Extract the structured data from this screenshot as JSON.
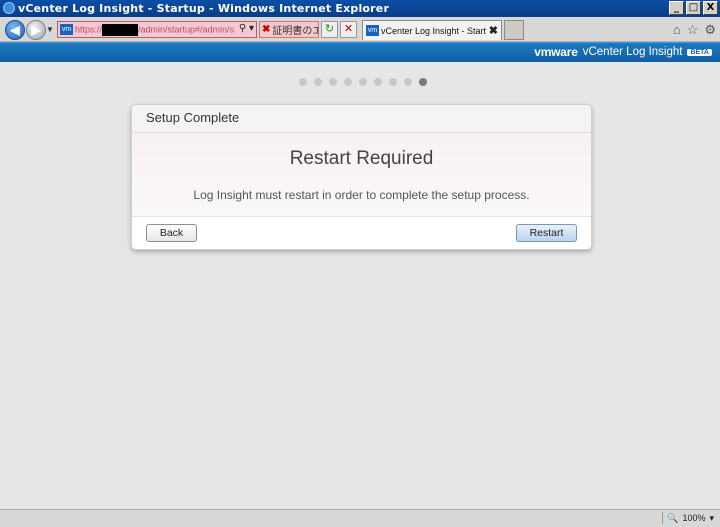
{
  "window": {
    "title": "vCenter Log Insight - Startup - Windows Internet Explorer",
    "minimize": "_",
    "maximize": "□",
    "close": "X"
  },
  "browser": {
    "address_prefix": "https://",
    "address_suffix": "/admin/startup#/admin/s",
    "address_icons": "⚲ ▾",
    "cert_error": "証明書のエ...",
    "tab_label": "vCenter Log Insight - Start...",
    "tab_close": "✖",
    "vm_badge": "vm",
    "back_arrow": "◀",
    "forward_arrow": "▶",
    "dropdown": "▼",
    "refresh_glyph": "↻",
    "stop_glyph": "✕",
    "home_glyph": "⌂",
    "star_glyph": "☆",
    "gear_glyph": "⚙"
  },
  "header": {
    "brand": "vmware",
    "product": "vCenter Log Insight",
    "badge": "BETA"
  },
  "steps": {
    "total": 9,
    "current": 9
  },
  "dialog": {
    "title": "Setup Complete",
    "heading": "Restart Required",
    "message": "Log Insight must restart in order to complete the setup process.",
    "back_label": "Back",
    "restart_label": "Restart"
  },
  "status": {
    "zoom_icon": "🔍",
    "zoom": "100%",
    "zoom_arrow": "▾"
  }
}
